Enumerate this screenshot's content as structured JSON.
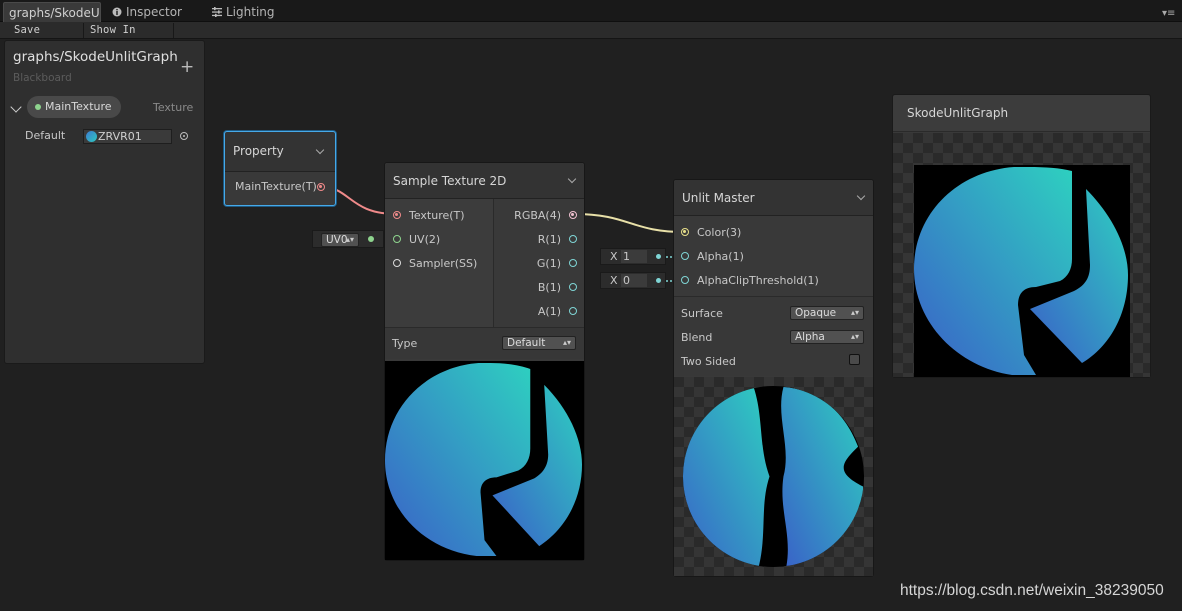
{
  "tabs": [
    {
      "label": "graphs/SkodeU"
    },
    {
      "label": "Inspector"
    },
    {
      "label": "Lighting"
    }
  ],
  "toolbar": {
    "save_asset": "Save Asset",
    "show_in_project": "Show In Project"
  },
  "blackboard": {
    "title": "graphs/SkodeUnlitGraph",
    "subtitle": "Blackboard",
    "add_icon": "+",
    "property": {
      "name": "MainTexture",
      "type": "Texture",
      "default_label": "Default",
      "default_value": "ZRVR01"
    }
  },
  "property_node": {
    "title": "Property",
    "output": "MainTexture(T)"
  },
  "sample_node": {
    "title": "Sample Texture 2D",
    "inputs": [
      "Texture(T)",
      "UV(2)",
      "Sampler(SS)"
    ],
    "outputs": [
      "RGBA(4)",
      "R(1)",
      "G(1)",
      "B(1)",
      "A(1)"
    ],
    "type_label": "Type",
    "type_value": "Default",
    "uv_value": "UV0"
  },
  "unlit_node": {
    "title": "Unlit Master",
    "inputs": [
      "Color(3)",
      "Alpha(1)",
      "AlphaClipThreshold(1)"
    ],
    "alpha_value": "1",
    "clip_value": "0",
    "x_label": "X",
    "surface_label": "Surface",
    "surface_value": "Opaque",
    "blend_label": "Blend",
    "blend_value": "Alpha",
    "two_sided_label": "Two Sided"
  },
  "main_preview": {
    "title": "SkodeUnlitGraph"
  },
  "watermark": "https://blog.csdn.net/weixin_38239050",
  "colors": {
    "texture_port": "#f08a8a",
    "color_port": "#e8e08a",
    "float_port": "#7fd5d5",
    "selection": "#47a9e8",
    "logo_a": "#3a6fc9",
    "logo_b": "#2ec8c0"
  }
}
